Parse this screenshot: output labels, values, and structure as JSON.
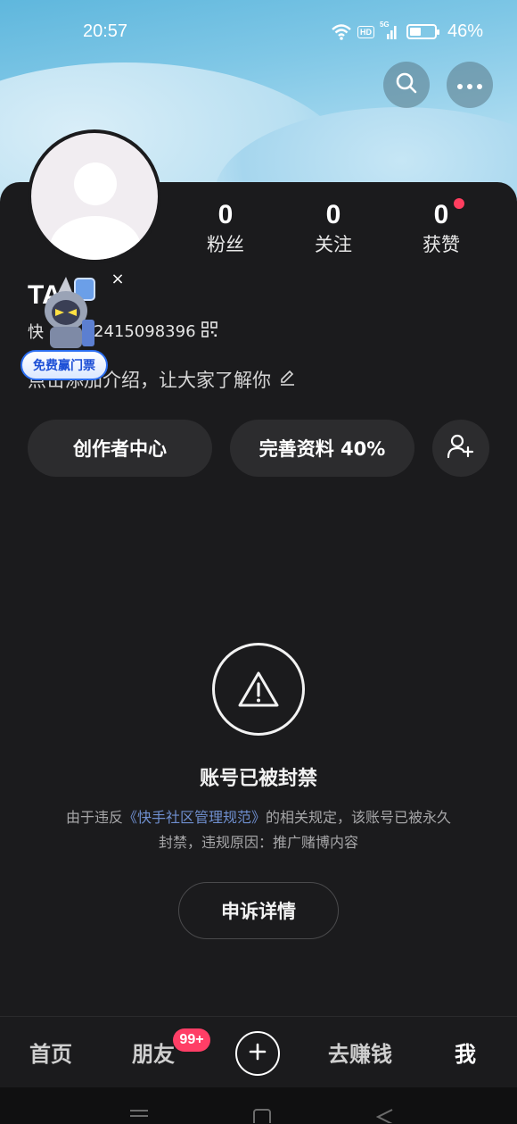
{
  "status_bar": {
    "time": "20:57",
    "hd_label": "HD",
    "signal_label": "5G",
    "battery_level": 0.46,
    "battery_text": "46%"
  },
  "header": {
    "search_icon": "search-icon",
    "more_icon": "more-icon"
  },
  "profile": {
    "name": "TA",
    "id_prefix": "快",
    "id_value": "2415098396",
    "bio": "点击添加介绍，让大家了解你",
    "stats": [
      {
        "value": "0",
        "label": "粉丝"
      },
      {
        "value": "0",
        "label": "关注"
      },
      {
        "value": "0",
        "label": "获赞",
        "has_dot": true
      }
    ]
  },
  "promo": {
    "badge_text": "免费赢门票",
    "close_label": "×"
  },
  "actions": {
    "creator_center": "创作者中心",
    "complete_profile": "完善资料 40%",
    "add_friend_icon": "add-friend-icon"
  },
  "ban": {
    "title": "账号已被封禁",
    "desc_before": "由于违反",
    "desc_link": "《快手社区管理规范》",
    "desc_after": "的相关规定，该账号已被永久封禁，违规原因：推广赌博内容",
    "appeal_label": "申诉详情"
  },
  "tabbar": {
    "home": "首页",
    "friends": "朋友",
    "friends_badge": "99+",
    "earn": "去赚钱",
    "me": "我"
  },
  "colors": {
    "background": "#1b1b1d",
    "pill": "#2c2c2e",
    "badge_red": "#ff3e66",
    "link_blue": "#6f8fcf"
  }
}
